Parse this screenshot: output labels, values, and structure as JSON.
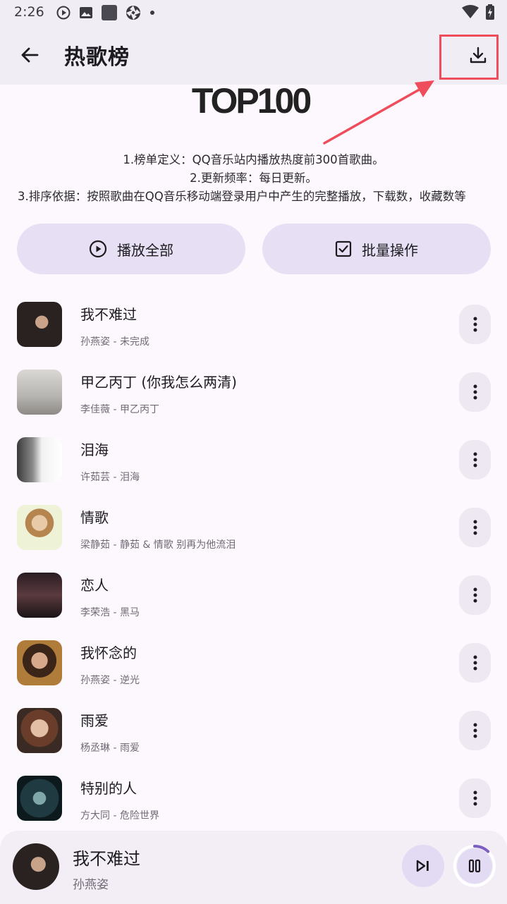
{
  "status": {
    "time": "2:26"
  },
  "appbar": {
    "title": "热歌榜"
  },
  "header": {
    "logo_text": "TOP100"
  },
  "description": {
    "line1": "1.榜单定义：QQ音乐站内播放热度前300首歌曲。",
    "line2": "2.更新频率：每日更新。",
    "line3": "3.排序依据：按照歌曲在QQ音乐移动端登录用户中产生的完整播放，下载数，收藏数等"
  },
  "actions": {
    "play_all": "播放全部",
    "batch": "批量操作"
  },
  "songs": [
    {
      "title": "我不难过",
      "subtitle": "孙燕姿 - 未完成"
    },
    {
      "title": "甲乙丙丁 (你我怎么两清)",
      "subtitle": "李佳薇 - 甲乙丙丁"
    },
    {
      "title": "泪海",
      "subtitle": "许茹芸 - 泪海"
    },
    {
      "title": "情歌",
      "subtitle": "梁静茹 - 静茹 & 情歌 别再为他流泪"
    },
    {
      "title": "恋人",
      "subtitle": "李荣浩 - 黑马"
    },
    {
      "title": "我怀念的",
      "subtitle": "孙燕姿 - 逆光"
    },
    {
      "title": "雨爱",
      "subtitle": "杨丞琳 - 雨爱"
    },
    {
      "title": "特别的人",
      "subtitle": "方大同 - 危险世界"
    }
  ],
  "player": {
    "title": "我不难过",
    "artist": "孙燕姿",
    "progress": 0.12
  },
  "colors": {
    "accent": "#e7e0f5",
    "highlight": "#ef4d5c",
    "progress": "#7b5fc2"
  }
}
